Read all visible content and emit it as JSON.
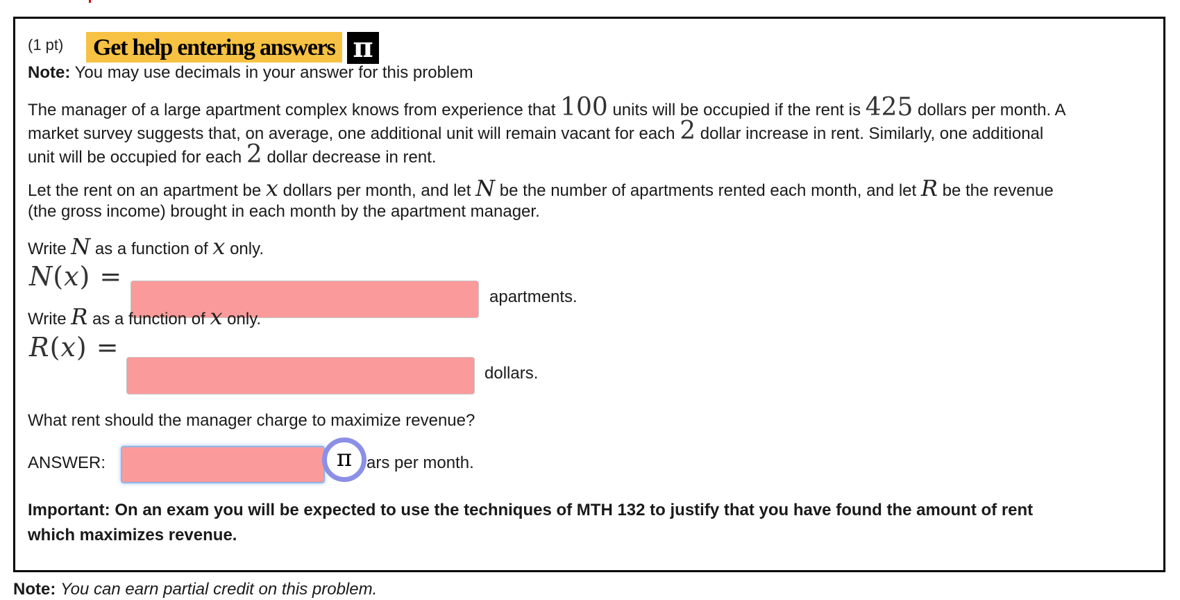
{
  "header": {
    "points": "(1 pt)",
    "help_label": "Get help entering answers",
    "help_icon": "π"
  },
  "note": {
    "label": "Note:",
    "text": "You may use decimals in your answer for this problem"
  },
  "paragraph1": {
    "line1_a": "The manager of a large apartment complex knows from experience that",
    "units": "100",
    "line1_b": "units will be occupied if the rent is",
    "rent": "425",
    "line1_c": "dollars per month. A",
    "line2_a": "market survey suggests that, on average, one additional unit will remain vacant for each",
    "step_up": "2",
    "line2_b": "dollar increase in rent. Similarly, one additional",
    "line3_a": "unit will be occupied for each",
    "step_down": "2",
    "line3_b": "dollar decrease in rent."
  },
  "paragraph2": {
    "line1_a": "Let the rent on an apartment be",
    "var_x": "x",
    "line1_b": "dollars per month, and let",
    "var_n": "N",
    "line1_c": "be the number of apartments rented each month, and let",
    "var_r": "R",
    "line1_d": "be the revenue",
    "line2": "(the gross income) brought in each month by the apartment manager."
  },
  "question_n": {
    "prompt_a": "Write",
    "var": "N",
    "prompt_b": "as a function of",
    "var_x": "x",
    "prompt_c": "only.",
    "eq_fn": "N",
    "eq_arg": "x",
    "input_value": "",
    "unit": "apartments."
  },
  "question_r": {
    "prompt_a": "Write",
    "var": "R",
    "prompt_b": "as a function of",
    "var_x": "x",
    "prompt_c": "only.",
    "eq_fn": "R",
    "eq_arg": "x",
    "input_value": "",
    "unit": "dollars."
  },
  "question_max": {
    "prompt": "What rent should the manager charge to maximize revenue?",
    "answer_label": "ANSWER:",
    "input_value": "",
    "pi_button": "π",
    "unit_visible": "ars per month."
  },
  "important": {
    "line1": "Important: On an exam you will be expected to use the techniques of MTH 132 to justify that you have found the amount of rent",
    "line2": "which maximizes revenue."
  },
  "footer_note": {
    "label": "Note:",
    "text": "You can earn partial credit on this problem."
  },
  "colors": {
    "help_bg": "#f7c243",
    "answer_field_bg": "#fb9a9a",
    "focus_ring": "#8c8fe6",
    "border": "#000000"
  }
}
